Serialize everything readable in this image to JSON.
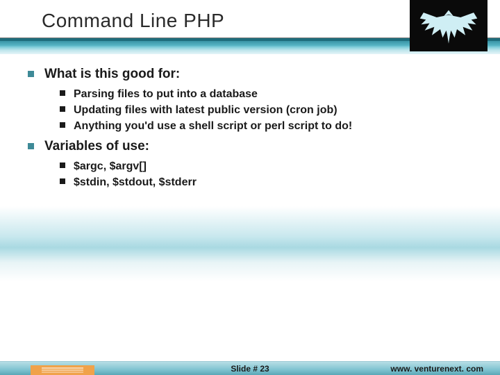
{
  "title": "Command Line PHP",
  "bullets": [
    {
      "label": "What is this good for:",
      "sub": [
        "Parsing files to put into a database",
        "Updating files with latest public version (cron job)",
        "Anything you'd use a shell script or perl script to do!"
      ]
    },
    {
      "label": "Variables of use:",
      "sub": [
        "$argc, $argv[]",
        "$stdin, $stdout, $stderr"
      ]
    }
  ],
  "footer": {
    "slide_label": "Slide # 23",
    "url": "www. venturenext. com"
  }
}
